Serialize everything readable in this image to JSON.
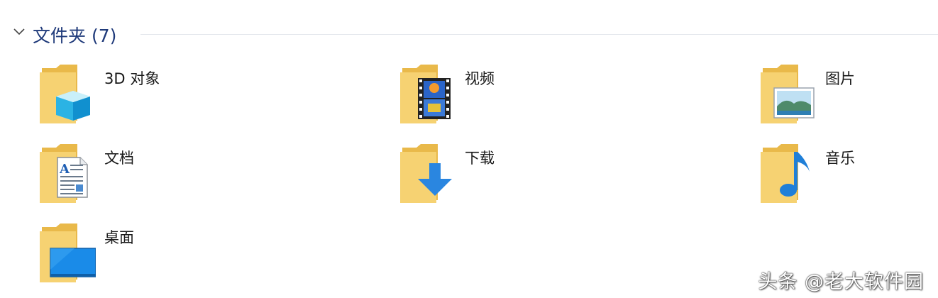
{
  "group": {
    "title": "文件夹 (7)",
    "colors": {
      "title": "#1f3a7a",
      "folder": "#f6d272",
      "folder_back": "#e9b94a"
    }
  },
  "folders": [
    {
      "label": "3D 对象",
      "icon": "3d-objects-icon"
    },
    {
      "label": "视频",
      "icon": "video-film-icon"
    },
    {
      "label": "图片",
      "icon": "picture-landscape-icon"
    },
    {
      "label": "文档",
      "icon": "document-icon"
    },
    {
      "label": "下载",
      "icon": "download-arrow-icon"
    },
    {
      "label": "音乐",
      "icon": "music-note-icon"
    },
    {
      "label": "桌面",
      "icon": "desktop-monitor-icon"
    }
  ],
  "watermark": "头条 @老大软件园"
}
